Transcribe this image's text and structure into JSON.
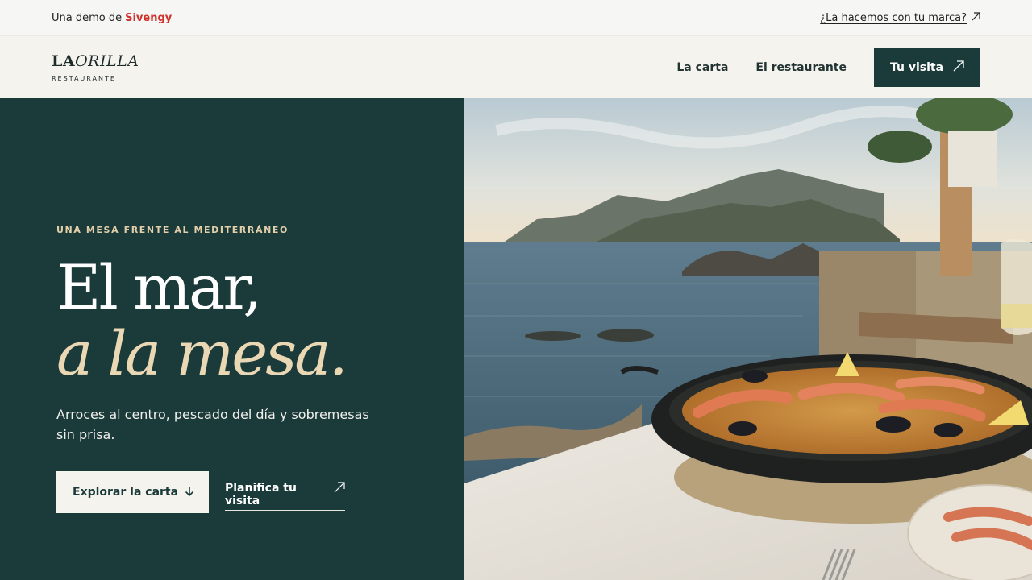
{
  "demo_bar": {
    "prefix": "Una demo de",
    "brand": "Sivengy",
    "cta": "¿La hacemos con tu marca?",
    "brand_color": "#d0302a"
  },
  "header": {
    "logo_la": "LA",
    "logo_orilla": "ORILLA",
    "logo_sub": "RESTAURANTE",
    "nav": [
      {
        "label": "La carta"
      },
      {
        "label": "El restaurante"
      }
    ],
    "cta": "Tu visita"
  },
  "hero": {
    "eyebrow": "UNA MESA FRENTE AL MEDITERRÁNEO",
    "title_line1": "El mar,",
    "title_line2": "a la mesa.",
    "subtitle": "Arroces al centro, pescado del día y sobremesas sin prisa.",
    "primary_button": "Explorar la carta",
    "secondary_link": "Planifica tu visita",
    "image": "paella-on-terrace-overlooking-sea"
  },
  "colors": {
    "primary": "#1b3a3a",
    "accent": "#ead8b4",
    "background": "#f5f3ee"
  }
}
